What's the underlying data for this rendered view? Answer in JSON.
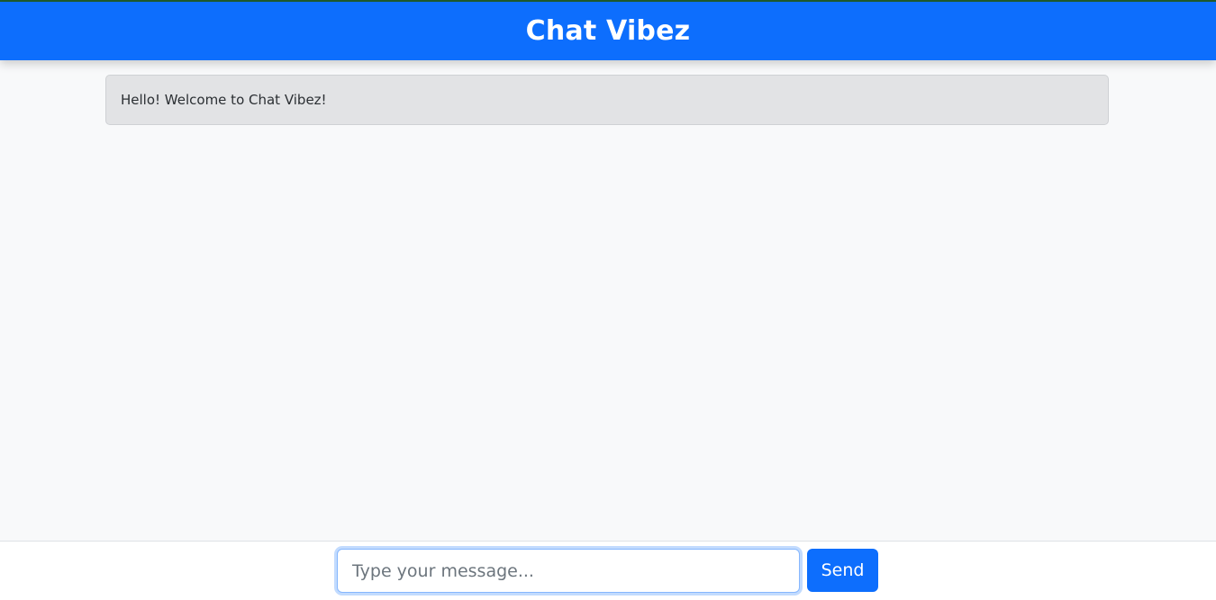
{
  "app": {
    "title": "Chat Vibez"
  },
  "messages": [
    {
      "text": "Hello! Welcome to Chat Vibez!"
    }
  ],
  "composer": {
    "placeholder": "Type your message...",
    "value": "",
    "send_label": "Send"
  },
  "colors": {
    "primary": "#0d6efd",
    "background": "#f8f9fa",
    "message_bg": "#e2e3e5"
  }
}
